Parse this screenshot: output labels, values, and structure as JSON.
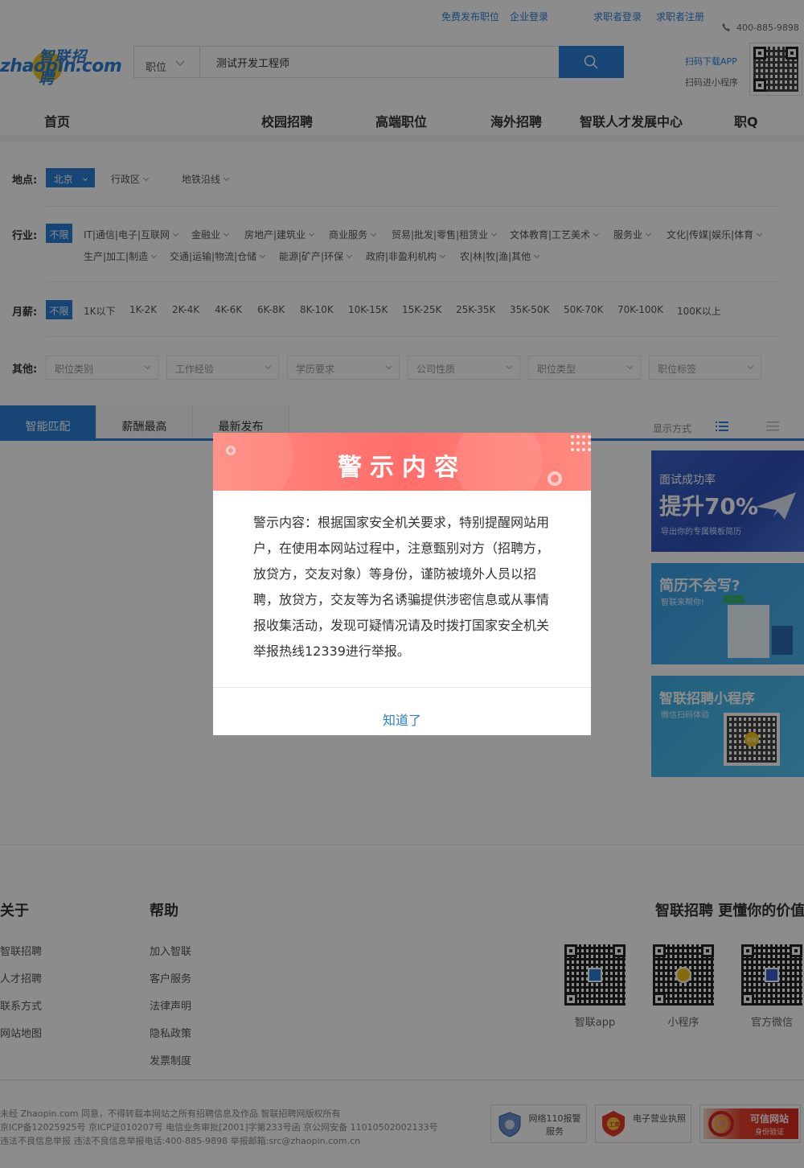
{
  "topbar": {
    "post_job": "免费发布职位",
    "enterprise_login": "企业登录",
    "seeker_login": "求职者登录",
    "seeker_register": "求职者注册",
    "phone": "400-885-9898"
  },
  "header": {
    "logo_cn": "智联招聘",
    "logo_en": "zhaopin.com",
    "search_category": "职位",
    "search_value": "测试开发工程师",
    "download_app": "扫码下载APP",
    "mini_program": "扫码进小程序"
  },
  "nav": {
    "items": [
      "首页",
      "校园招聘",
      "高端职位",
      "海外招聘",
      "智联人才发展中心",
      "职Q"
    ]
  },
  "filters": {
    "location": {
      "label": "地点:",
      "selected": "北京",
      "options": [
        "行政区",
        "地铁沿线"
      ]
    },
    "industry": {
      "label": "行业:",
      "selected": "不限",
      "options_row1": [
        "IT|通信|电子|互联网",
        "金融业",
        "房地产|建筑业",
        "商业服务",
        "贸易|批发|零售|租赁业",
        "文体教育|工艺美术",
        "服务业",
        "文化|传媒|娱乐|体育"
      ],
      "options_row2": [
        "生产|加工|制造",
        "交通|运输|物流|仓储",
        "能源|矿产|环保",
        "政府|非盈利机构",
        "农|林|牧|渔|其他"
      ]
    },
    "salary": {
      "label": "月薪:",
      "selected": "不限",
      "options": [
        "1K以下",
        "1K-2K",
        "2K-4K",
        "4K-6K",
        "6K-8K",
        "8K-10K",
        "10K-15K",
        "15K-25K",
        "25K-35K",
        "35K-50K",
        "50K-70K",
        "70K-100K",
        "100K以上"
      ]
    },
    "other": {
      "label": "其他:",
      "selects": [
        "职位类别",
        "工作经验",
        "学历要求",
        "公司性质",
        "职位类型",
        "职位标签"
      ]
    }
  },
  "sort": {
    "tabs": [
      "智能匹配",
      "薪酬最高",
      "最新发布"
    ],
    "display_mode": "显示方式"
  },
  "banners": {
    "b1_line1": "面试成功率",
    "b1_big": "提升70%",
    "b1_small": "导出你的专属模板简历",
    "b2_big": "简历不会写?",
    "b2_small": "智联来帮你!",
    "b3_big": "智联招聘小程序",
    "b3_small": "微信扫码体验",
    "b3_badge": "智联"
  },
  "modal": {
    "title": "警示内容",
    "body": "警示内容：根据国家安全机关要求，特别提醒网站用户，在使用本网站过程中，注意甄别对方（招聘方，放贷方，交友对象）等身份，谨防被境外人员以招聘，放贷方，交友等为名诱骗提供涉密信息或从事情报收集活动，发现可疑情况请及时拨打国家安全机关举报热线12339进行举报。",
    "confirm": "知道了"
  },
  "footer": {
    "about_title": "关于",
    "about_links": [
      "智联招聘",
      "人才招聘",
      "联系方式",
      "网站地图"
    ],
    "help_title": "帮助",
    "help_links": [
      "加入智联",
      "客户服务",
      "法律声明",
      "隐私政策",
      "发票制度"
    ],
    "slogan": "智联招聘 更懂你的价值",
    "qr_labels": [
      "智联app",
      "小程序",
      "官方微信"
    ],
    "legal_line1": "未经 Zhaopin.com 同意，不得转载本网站之所有招聘信息及作品 智联招聘网版权所有",
    "legal_line2": "京ICP备12025925号 京ICP证010207号 电信业务审批[2001]字第233号函 京公网安备 11010502002133号",
    "legal_line3": "违法不良信息举报 违法不良信息举报电话:400-885-9898 举报邮箱:src@zhaopin.com.cn",
    "cert1": "网络110报警服务",
    "cert2": "电子营业执照",
    "cert3_line1": "可信网站",
    "cert3_line2": "身份验证",
    "cert2_badge": "工商"
  }
}
